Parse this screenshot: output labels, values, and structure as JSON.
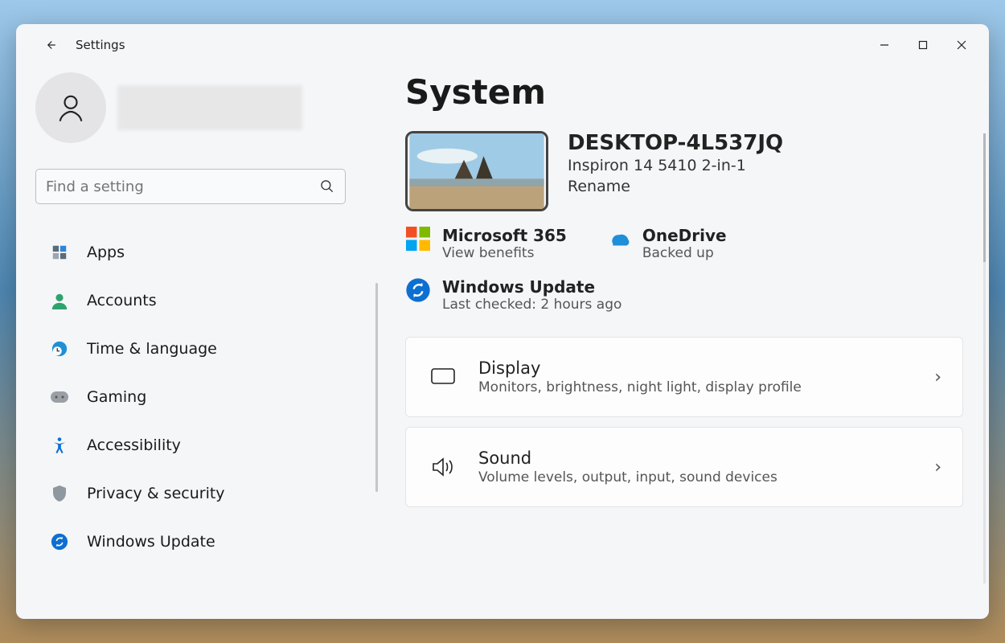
{
  "window": {
    "title": "Settings"
  },
  "search": {
    "placeholder": "Find a setting"
  },
  "sidebar": {
    "items": [
      {
        "label": "Apps"
      },
      {
        "label": "Accounts"
      },
      {
        "label": "Time & language"
      },
      {
        "label": "Gaming"
      },
      {
        "label": "Accessibility"
      },
      {
        "label": "Privacy & security"
      },
      {
        "label": "Windows Update"
      }
    ]
  },
  "main": {
    "title": "System",
    "device": {
      "name": "DESKTOP-4L537JQ",
      "model": "Inspiron 14 5410 2-in-1",
      "rename": "Rename"
    },
    "status": {
      "m365": {
        "label": "Microsoft 365",
        "sub": "View benefits"
      },
      "onedrive": {
        "label": "OneDrive",
        "sub": "Backed up"
      },
      "update": {
        "label": "Windows Update",
        "sub": "Last checked: 2 hours ago"
      }
    },
    "cards": [
      {
        "title": "Display",
        "sub": "Monitors, brightness, night light, display profile"
      },
      {
        "title": "Sound",
        "sub": "Volume levels, output, input, sound devices"
      }
    ]
  }
}
